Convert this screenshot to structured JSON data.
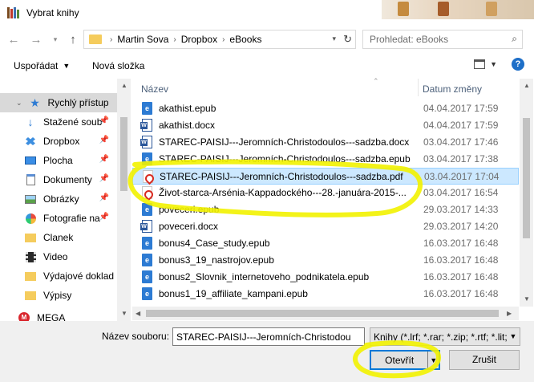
{
  "window": {
    "title": "Vybrat knihy"
  },
  "nav": {
    "path": [
      "Martin Sova",
      "Dropbox",
      "eBooks"
    ],
    "search_placeholder": "Prohledat: eBooks"
  },
  "toolbar": {
    "organize_label": "Uspořádat",
    "new_folder_label": "Nová složka"
  },
  "sidebar": {
    "items": [
      {
        "label": "Rychlý přístup",
        "icon": "star-icon",
        "pinned": false
      },
      {
        "label": "Stažené soub",
        "icon": "download-icon",
        "pinned": true
      },
      {
        "label": "Dropbox",
        "icon": "dropbox-icon",
        "pinned": true
      },
      {
        "label": "Plocha",
        "icon": "desktop-icon",
        "pinned": true
      },
      {
        "label": "Dokumenty",
        "icon": "documents-icon",
        "pinned": true
      },
      {
        "label": "Obrázky",
        "icon": "pictures-icon",
        "pinned": true
      },
      {
        "label": "Fotografie na",
        "icon": "photos-icon",
        "pinned": true
      },
      {
        "label": "Clanek",
        "icon": "folder-icon",
        "pinned": false
      },
      {
        "label": "Video",
        "icon": "video-icon",
        "pinned": false
      },
      {
        "label": "Výdajové doklad",
        "icon": "folder-icon",
        "pinned": false
      },
      {
        "label": "Výpisy",
        "icon": "folder-icon",
        "pinned": false
      },
      {
        "label": "MEGA",
        "icon": "mega-icon",
        "pinned": false
      }
    ]
  },
  "filelist": {
    "col_name": "Název",
    "col_date": "Datum změny",
    "files": [
      {
        "name": "akathist.epub",
        "date": "04.04.2017 17:59",
        "type": "epub"
      },
      {
        "name": "akathist.docx",
        "date": "04.04.2017 17:59",
        "type": "docx"
      },
      {
        "name": "STAREC-PAISIJ---Jeromních-Christodoulos---sadzba.docx",
        "date": "03.04.2017 17:46",
        "type": "docx"
      },
      {
        "name": "STAREC-PAISIJ---Jeromních-Christodoulos---sadzba.epub",
        "date": "03.04.2017 17:38",
        "type": "epub"
      },
      {
        "name": "STAREC-PAISIJ---Jeromních-Christodoulos---sadzba.pdf",
        "date": "03.04.2017 17:04",
        "type": "pdf",
        "selected": true
      },
      {
        "name": "Život-starca-Arsénia-Kappadockého---28.-januára-2015-...",
        "date": "03.04.2017 16:54",
        "type": "pdf"
      },
      {
        "name": "poveceri.epub",
        "date": "29.03.2017 14:33",
        "type": "epub"
      },
      {
        "name": "poveceri.docx",
        "date": "29.03.2017 14:20",
        "type": "docx"
      },
      {
        "name": "bonus4_Case_study.epub",
        "date": "16.03.2017 16:48",
        "type": "epub"
      },
      {
        "name": "bonus3_19_nastrojov.epub",
        "date": "16.03.2017 16:48",
        "type": "epub"
      },
      {
        "name": "bonus2_Slovnik_internetoveho_podnikatela.epub",
        "date": "16.03.2017 16:48",
        "type": "epub"
      },
      {
        "name": "bonus1_19_affiliate_kampani.epub",
        "date": "16.03.2017 16:48",
        "type": "epub"
      }
    ]
  },
  "footer": {
    "filename_label": "Název souboru:",
    "filename_value": "STAREC-PAISIJ---Jeromních-Christodou",
    "filter_value": "Knihy (*.lrf; *.rar; *.zip; *.rtf; *.lit;",
    "open_label": "Otevřít",
    "cancel_label": "Zrušit"
  },
  "colors": {
    "selection": "#cce8ff",
    "highlighter": "#f2f200",
    "accent": "#0078d7"
  }
}
